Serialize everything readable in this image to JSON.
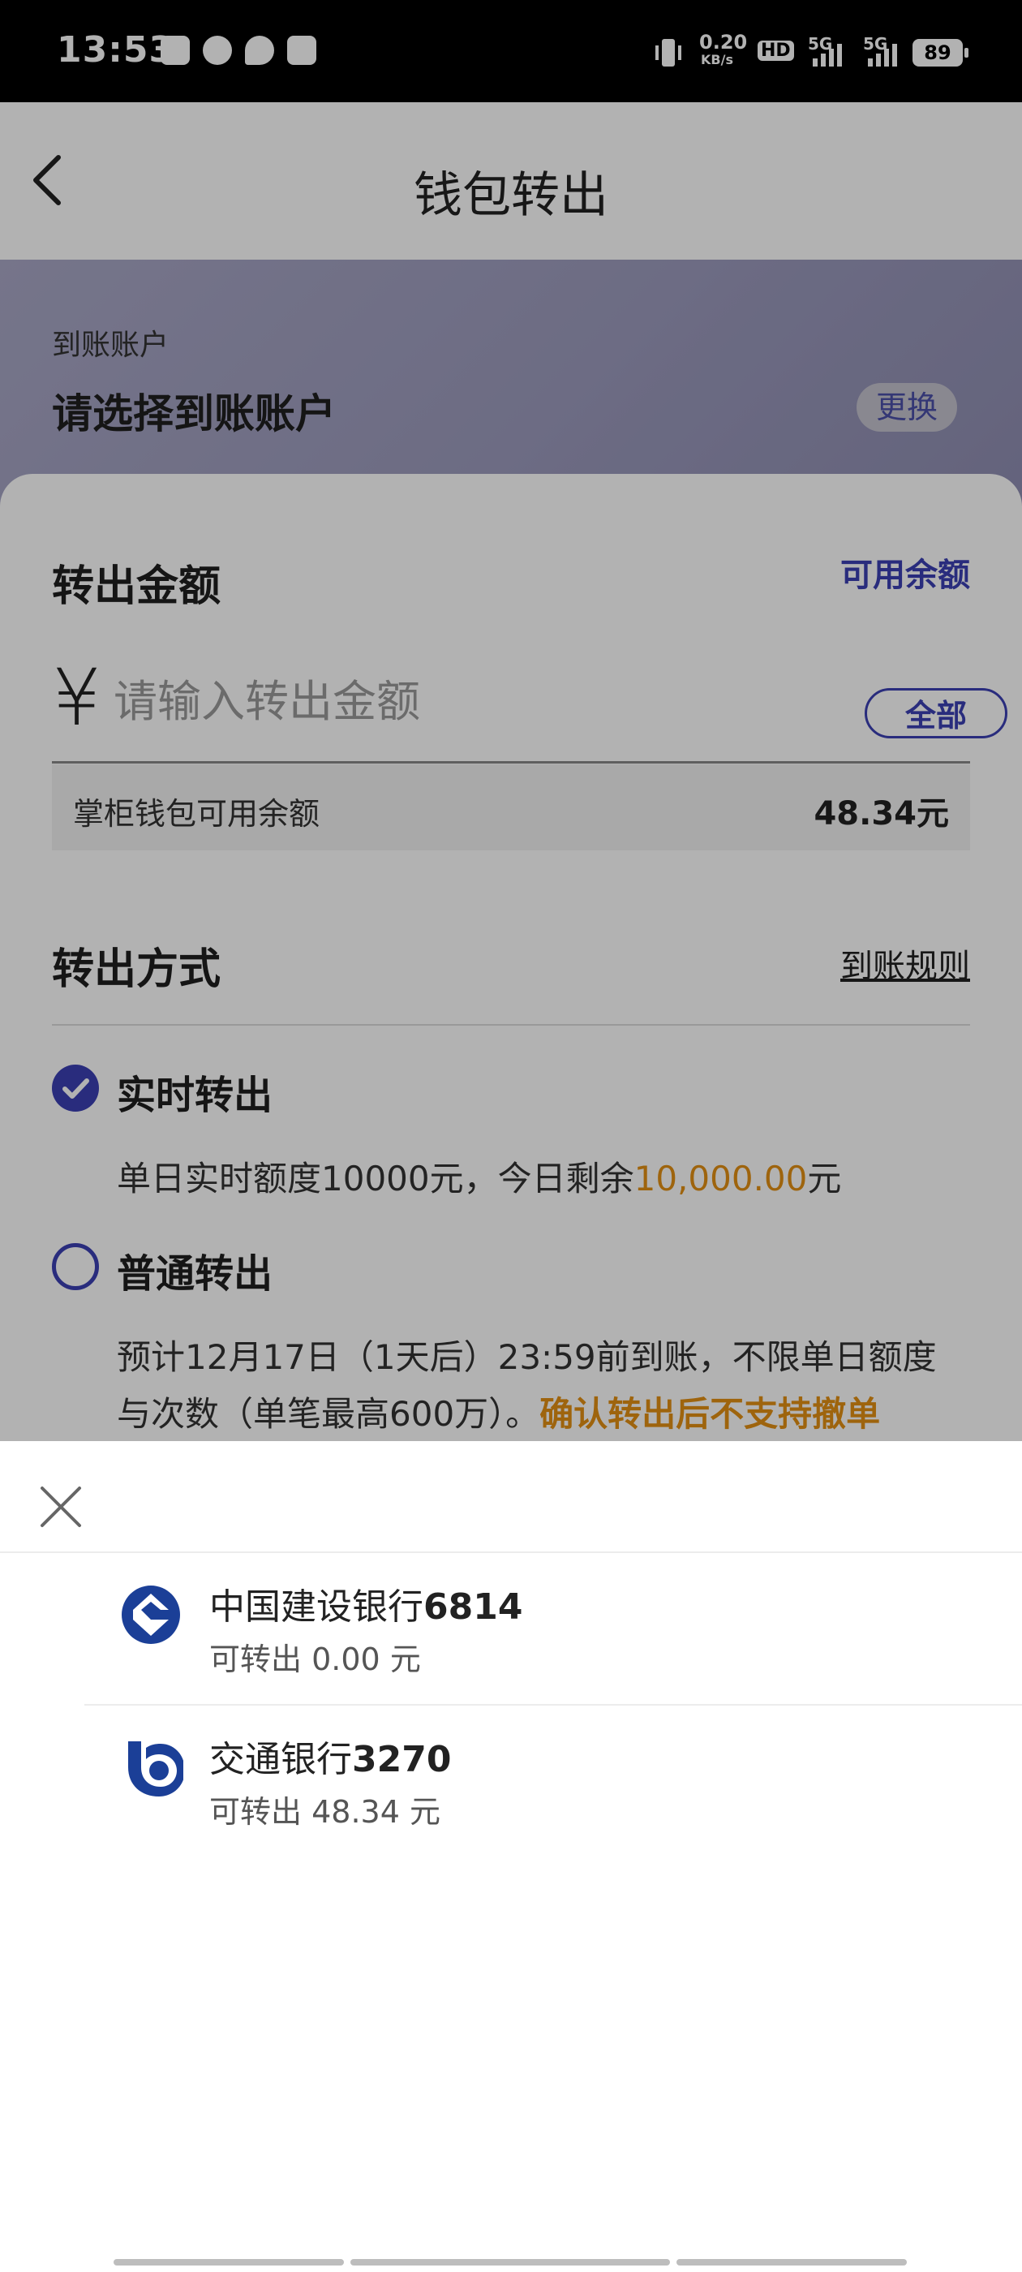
{
  "status_bar": {
    "time": "13:53",
    "net_speed_value": "0.20",
    "net_speed_unit": "KB/s",
    "hd_label": "HD",
    "signal1_label": "5G",
    "signal2_label": "5G",
    "battery": "89"
  },
  "header": {
    "title": "钱包转出",
    "back_icon": "chevron-left-icon"
  },
  "account": {
    "label": "到账账户",
    "value": "请选择到账账户",
    "swap_label": "更换"
  },
  "amount_section": {
    "title": "转出金额",
    "available_link": "可用余额",
    "currency_symbol": "¥",
    "input_placeholder": "请输入转出金额",
    "input_value": "",
    "all_button": "全部",
    "balance_label": "掌柜钱包可用余额",
    "balance_value": "48.34元"
  },
  "method_section": {
    "title": "转出方式",
    "rules_link": "到账规则",
    "options": [
      {
        "title": "实时转出",
        "checked": true,
        "desc_prefix": "单日实时额度10000元，今日剩余",
        "desc_highlight": "10,000.00",
        "desc_suffix": "元"
      },
      {
        "title": "普通转出",
        "checked": false,
        "desc_line1": "预计12月17日（1天后）23:59前到账，不限单日额度",
        "desc_line2_prefix": "与次数（单笔最高600万）。",
        "desc_line2_highlight": "确认转出后不支持撤单"
      }
    ]
  },
  "sheet": {
    "close_icon": "close-icon",
    "banks": [
      {
        "name": "中国建设银行",
        "tail": "6814",
        "avail_prefix": "可转出",
        "avail_value": "0.00",
        "avail_unit": "元",
        "logo": "ccb-logo-icon"
      },
      {
        "name": "交通银行",
        "tail": "3270",
        "avail_prefix": "可转出",
        "avail_value": "48.34",
        "avail_unit": "元",
        "logo": "bocom-logo-icon"
      }
    ]
  },
  "colors": {
    "accent": "#3b3fb3",
    "highlight": "#e39014"
  }
}
